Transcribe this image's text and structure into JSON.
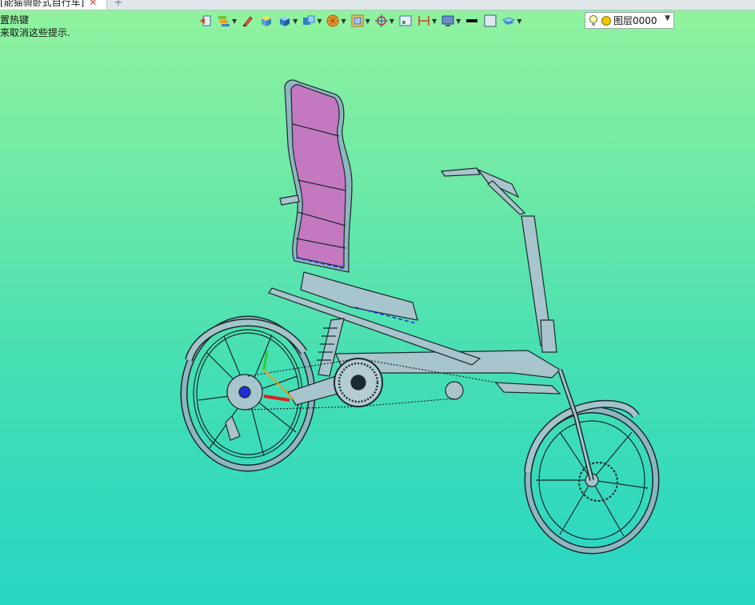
{
  "tabs": {
    "document_title": "[能猫骑卧式自行车]",
    "close_symbol": "✕",
    "new_tab_symbol": "+"
  },
  "hints": {
    "line1": "置热键",
    "line2": "来取消这些提示."
  },
  "toolbar": {
    "icons": [
      "back-icon",
      "layer-tools-icon",
      "pencil-icon",
      "box-yellow-icon",
      "cube-blue-icon",
      "view-cube-icon",
      "render-ball-icon",
      "shade-frame-icon",
      "snap-target-icon",
      "rect-select-icon",
      "dimension-icon",
      "screen-icon",
      "color-swatch-black",
      "color-swatch-white",
      "layer-stack-icon"
    ]
  },
  "layer": {
    "value": "图层0000",
    "bulb_color": "#f5d22b",
    "dot_color": "#f0c800"
  },
  "model": {
    "seat_color": "#c478c0",
    "frame_color": "#8fb6c0",
    "outline_color": "#1a2a2e"
  }
}
